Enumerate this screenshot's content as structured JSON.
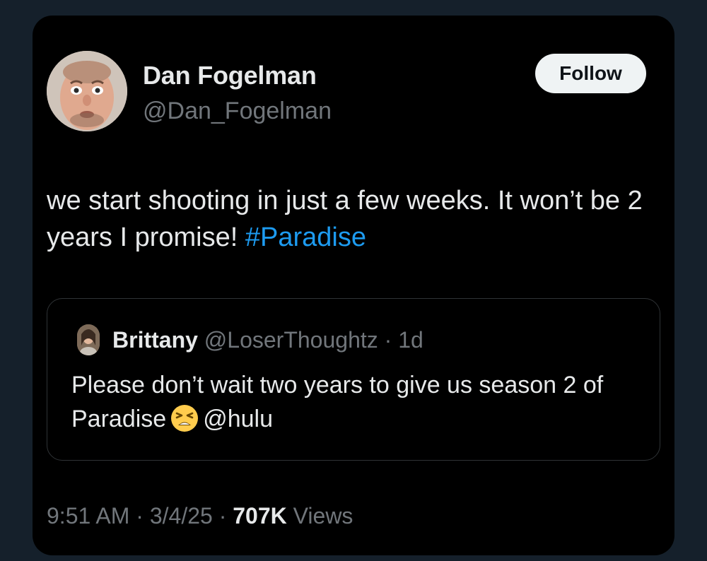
{
  "tweet": {
    "author": {
      "name": "Dan Fogelman",
      "handle": "@Dan_Fogelman"
    },
    "follow_label": "Follow",
    "text_main": "we start shooting in just a few weeks. It won’t be 2 years I promise! ",
    "hashtag": "#Paradise",
    "quote": {
      "name": "Brittany",
      "handle": "@LoserThoughtz",
      "separator": " · ",
      "age": "1d",
      "text_before_emoji": "Please don’t wait two years to give us season 2 of Paradise",
      "mention": "@hulu",
      "emoji": "tired-face-emoji"
    },
    "meta": {
      "time": "9:51 AM",
      "separator": " · ",
      "date": "3/4/25",
      "views_count": "707K",
      "views_label": "Views"
    }
  },
  "colors": {
    "background": "#15202b",
    "card": "#000000",
    "text": "#e7e9ea",
    "muted": "#71767b",
    "link": "#1d9bf0",
    "border": "#2f3336",
    "button": "#eff3f4"
  }
}
